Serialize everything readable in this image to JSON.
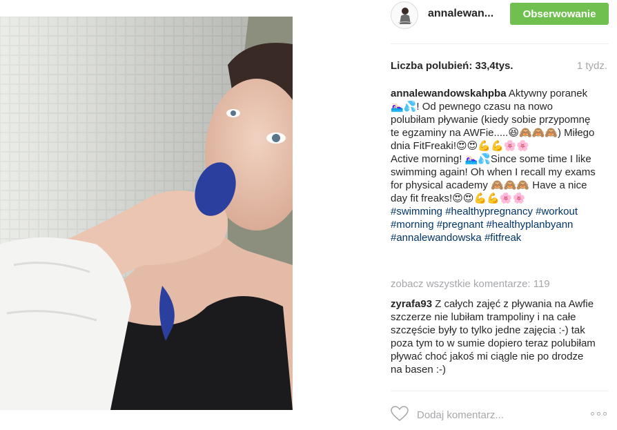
{
  "post": {
    "username": "annalewan...",
    "follow_label": "Obserwowanie",
    "likes_label": "Liczba polubień:",
    "likes_count": "33,4tys.",
    "time_ago": "1 tydz.",
    "caption": {
      "author": "annalewandowskahpba",
      "text_pl": "Aktywny poranek🏊🏻‍♀️💦! Od pewnego czasu na nowo polubiłam pływanie (kiedy sobie przypomnę te egzaminy na AWFie.....😆🙈🙈🙈) Miłego dnia FitFreaki!😍😍💪💪🌸🌸",
      "text_en": "Active morning! 🏊🏻‍♀️💦Since some time I like swimming again! Oh when I recall my exams for physical academy 🙈🙈🙈 Have a nice day fit freaks!😍😍💪💪🌸🌸",
      "hashtags": [
        "#swimming",
        "#healthypregnancy",
        "#workout",
        "#morning",
        "#pregnant",
        "#healthyplanbyann",
        "#annalewandowska",
        "#fitfreak"
      ]
    },
    "view_all_comments": "zobacz wszystkie komentarze: 119",
    "comments": [
      {
        "author": "zyrafa93",
        "text": "Z całych zajęć z pływania na Awfie szczerze nie lubiłam trampoliny i na całe szczęście były to tylko jedne zajęcia :-) tak poza tym to w sumie dopiero teraz polubiłam pływać choć jakoś mi ciągle nie po drodze na basen :-)"
      }
    ],
    "comment_placeholder": "Dodaj komentarz...",
    "icons": {
      "like": "heart-icon",
      "more": "more-options-icon",
      "avatar": "profile-avatar"
    },
    "colors": {
      "follow_button": "#70c050",
      "hashtag": "#003569",
      "muted": "#a5a7aa"
    }
  }
}
